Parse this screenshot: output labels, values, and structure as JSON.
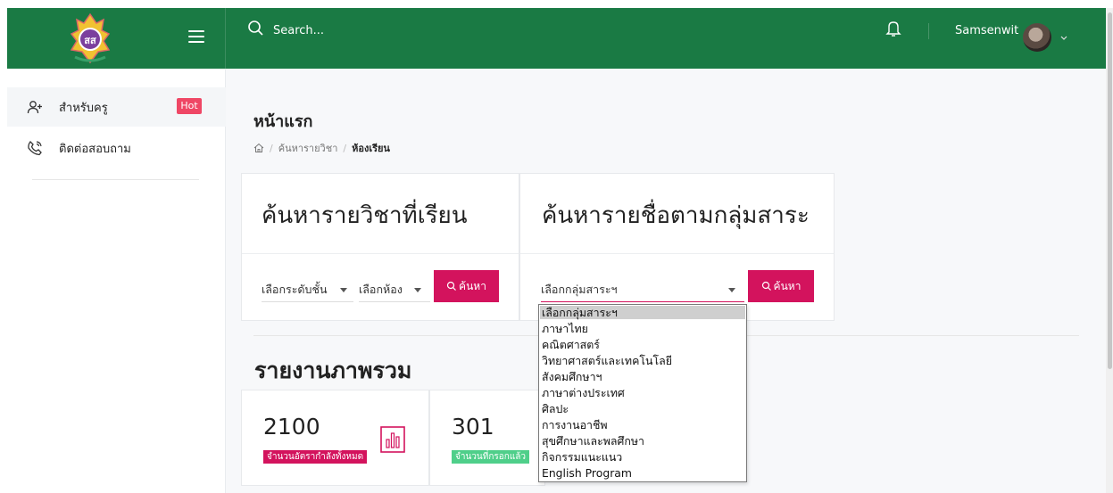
{
  "topbar": {
    "search_placeholder": "Search...",
    "username": "Samsenwit"
  },
  "sidebar": {
    "items": [
      {
        "label": "สำหรับครู",
        "badge": "Hot",
        "icon": "user-plus-icon"
      },
      {
        "label": "ติดต่อสอบถาม",
        "icon": "phone-icon"
      }
    ]
  },
  "main": {
    "page_title": "หน้าแรก",
    "breadcrumb": [
      "ค้นหารายวิชา",
      "ห้องเรียน"
    ],
    "card_left": {
      "title": "ค้นหารายวิชาที่เรียน",
      "select_level": "เลือกระดับชั้น",
      "select_room": "เลือกห้อง",
      "button": "ค้นหา"
    },
    "card_right": {
      "title": "ค้นหารายชื่อตามกลุ่มสาระ",
      "select_group": "เลือกกลุ่มสาระฯ",
      "button": "ค้นหา"
    },
    "dropdown_options": [
      "เลือกกลุ่มสาระฯ",
      "ภาษาไทย",
      "คณิตศาสตร์",
      "วิทยาศาสตร์และเทคโนโลยี",
      "สังคมศึกษาฯ",
      "ภาษาต่างประเทศ",
      "ศิลปะ",
      "การงานอาชีพ",
      "สุขศึกษาและพลศึกษา",
      "กิจกรรมแนะแนว",
      "English Program"
    ],
    "section_title": "รายงานภาพรวม",
    "stats": [
      {
        "value": "2100",
        "label": "จำนวนอัตรากำลังทั้งหมด",
        "color": "#d3135d"
      },
      {
        "value": "301",
        "label": "จำนวนที่กรอกแล้ว",
        "color": "#4fcf8a"
      }
    ]
  },
  "colors": {
    "topbar": "#1a7a44",
    "accent": "#d3135d",
    "hot": "#ef4765"
  }
}
